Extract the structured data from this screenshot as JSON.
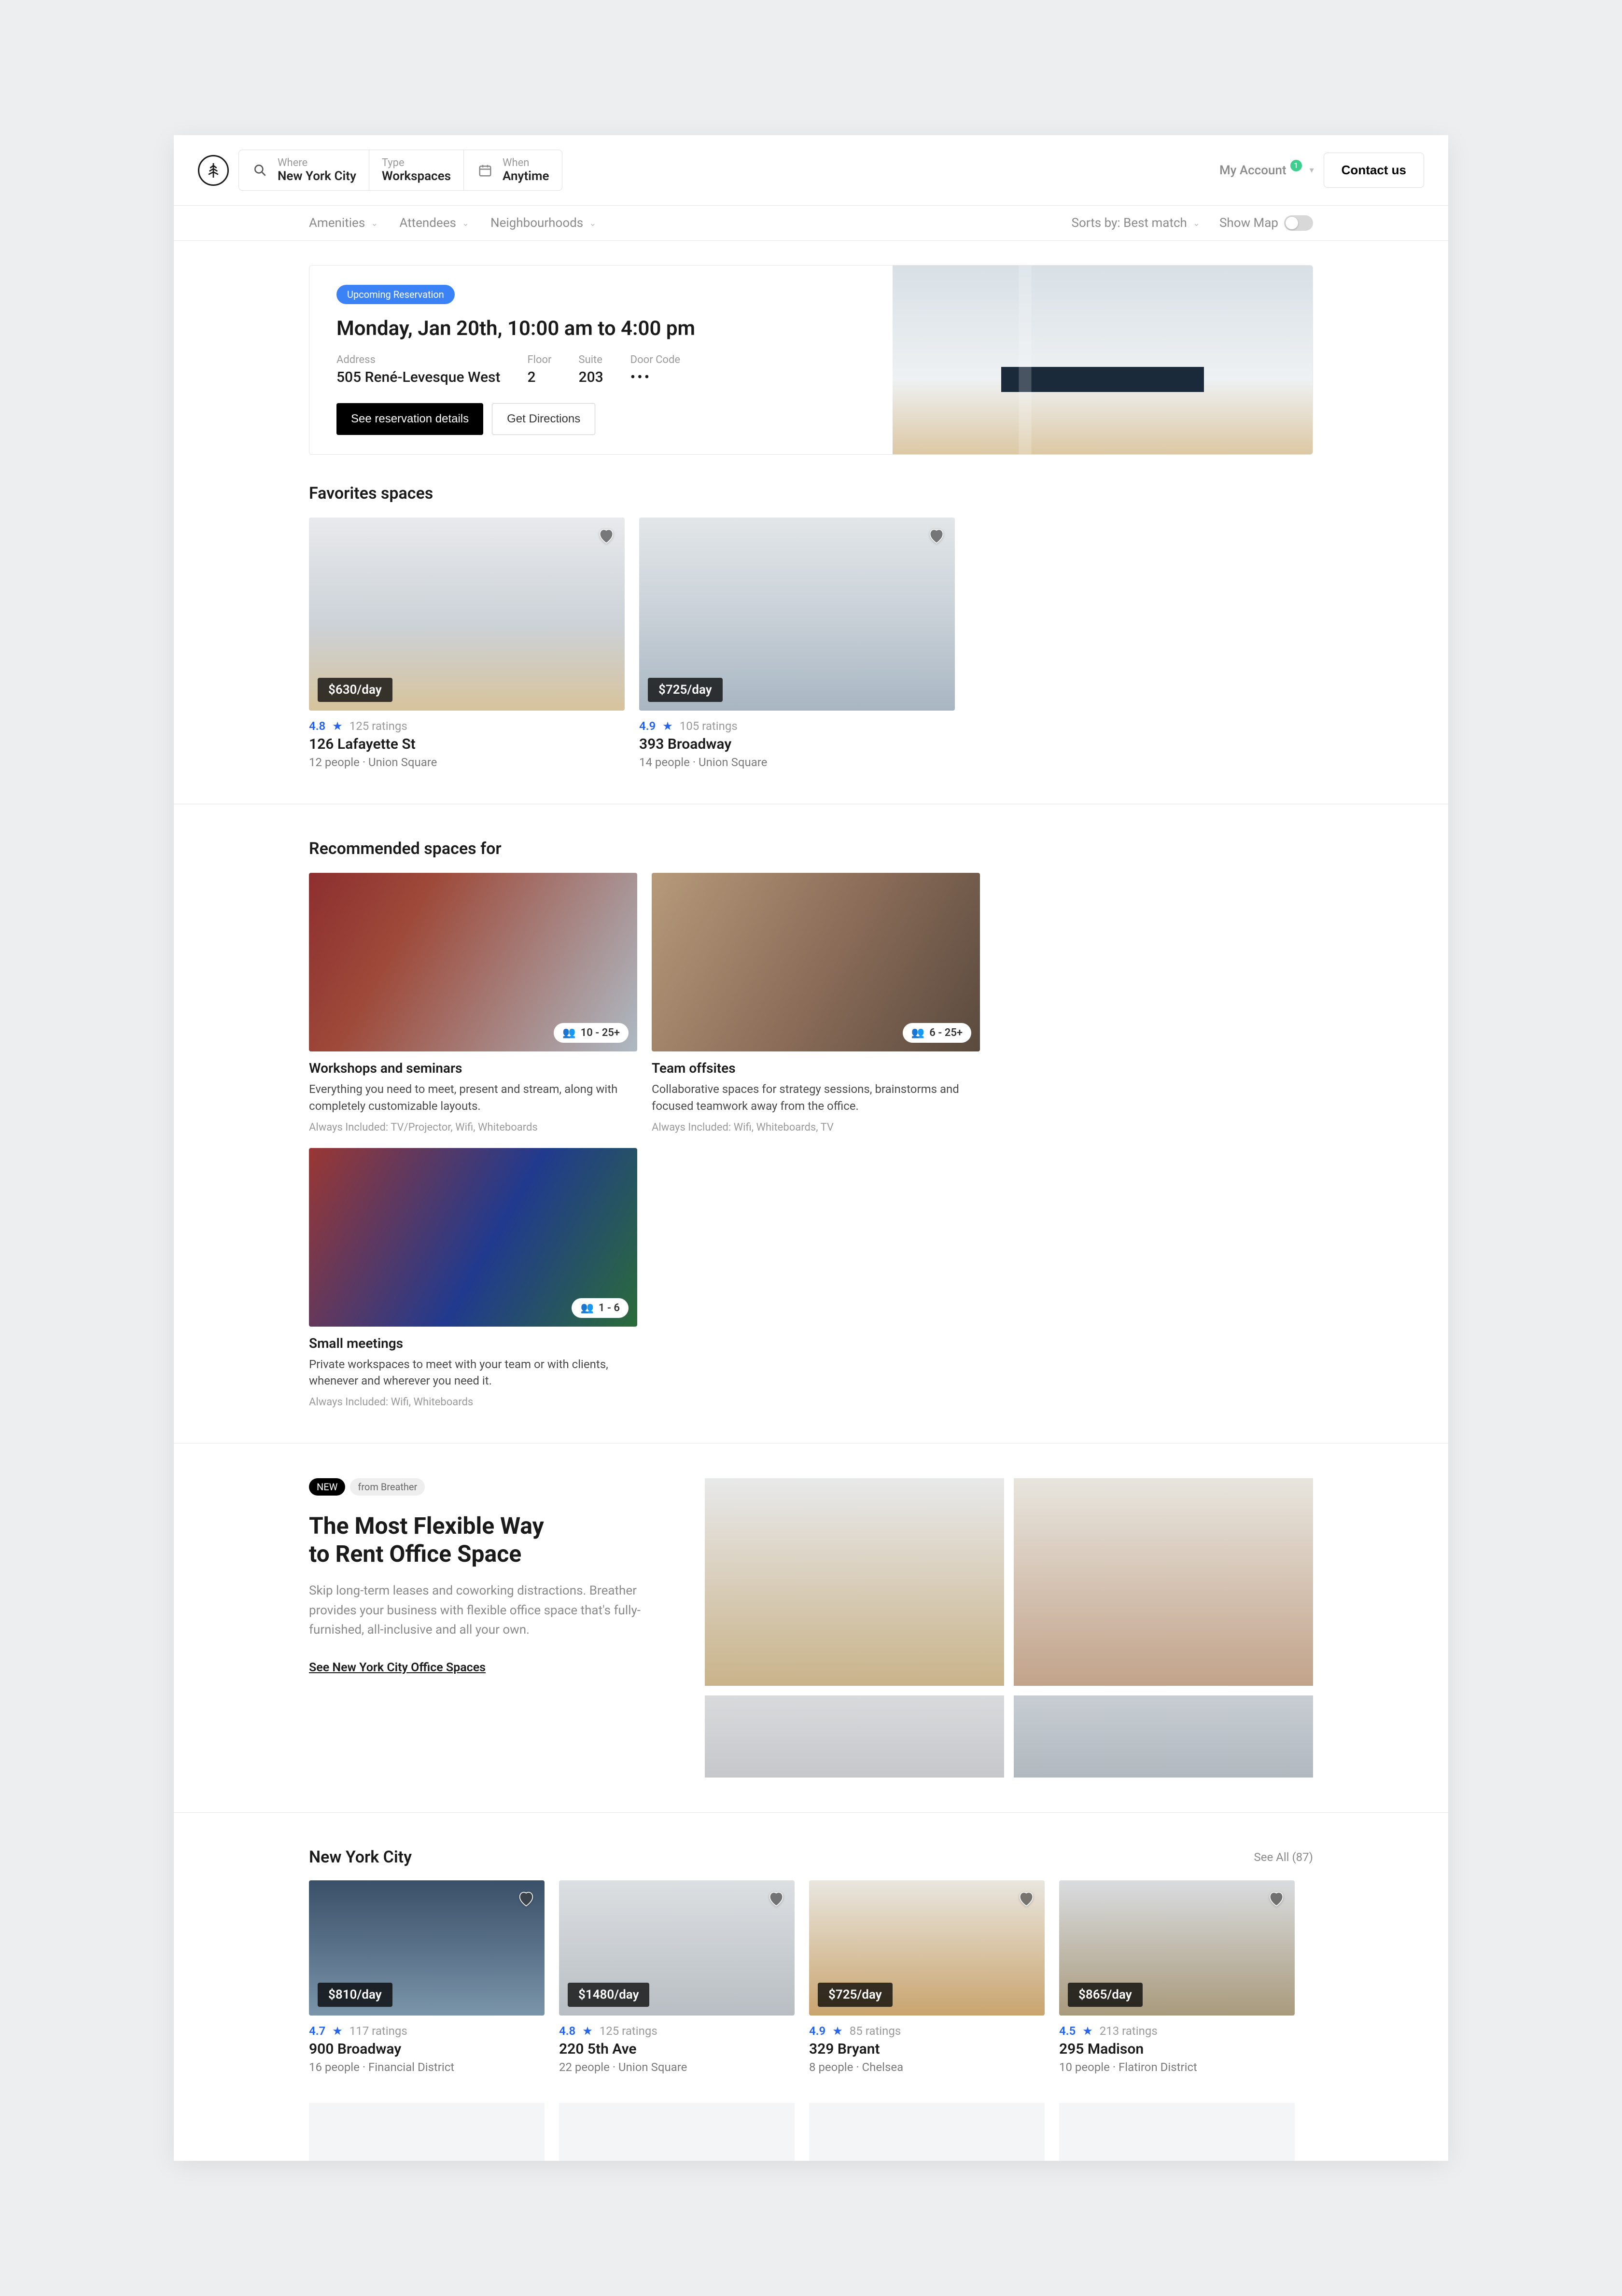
{
  "header": {
    "search": {
      "where_label": "Where",
      "where_value": "New York City",
      "type_label": "Type",
      "type_value": "Workspaces",
      "when_label": "When",
      "when_value": "Anytime"
    },
    "account_label": "My Account",
    "account_badge": "1",
    "contact_label": "Contact  us"
  },
  "filters": {
    "amenities": "Amenities",
    "attendees": "Attendees",
    "neighbourhoods": "Neighbourhoods",
    "sort_label": "Sorts by: Best match",
    "show_map": "Show Map"
  },
  "reservation": {
    "pill": "Upcoming Reservation",
    "title": "Monday, Jan 20th, 10:00 am to 4:00 pm",
    "address_label": "Address",
    "address_value": "505 René-Levesque West",
    "floor_label": "Floor",
    "floor_value": "2",
    "suite_label": "Suite",
    "suite_value": "203",
    "door_label": "Door Code",
    "door_value": "•••",
    "btn_details": "See reservation details",
    "btn_directions": "Get Directions"
  },
  "favorites": {
    "title": "Favorites spaces",
    "items": [
      {
        "price": "$630/day",
        "rating": "4.8",
        "ratings_count": "125 ratings",
        "name": "126 Lafayette St",
        "sub": "12 people · Union Square"
      },
      {
        "price": "$725/day",
        "rating": "4.9",
        "ratings_count": "105 ratings",
        "name": "393 Broadway",
        "sub": "14 people · Union Square"
      }
    ]
  },
  "recommended": {
    "title": "Recommended spaces for",
    "items": [
      {
        "cap": "10 - 25+",
        "name": "Workshops and seminars",
        "desc": "Everything you need to meet, present and stream, along with completely customizable layouts.",
        "inc": "Always Included: TV/Projector, Wifi, Whiteboards"
      },
      {
        "cap": "6 - 25+",
        "name": "Team offsites",
        "desc": "Collaborative spaces for strategy sessions, brainstorms and focused teamwork away from the office.",
        "inc": "Always Included: Wifi, Whiteboards, TV"
      },
      {
        "cap": "1 - 6",
        "name": "Small meetings",
        "desc": "Private workspaces to meet with your team or with clients, whenever and wherever you need it.",
        "inc": "Always Included: Wifi, Whiteboards"
      }
    ]
  },
  "promo": {
    "chip_new": "NEW",
    "chip_from": "from Breather",
    "heading1": "The Most Flexible Way",
    "heading2": "to Rent Office Space",
    "body": "Skip long-term leases and coworking distractions. Breather provides your business with flexible office space that's fully-furnished, all-inclusive and all your own.",
    "link": "See New York City Office Spaces"
  },
  "nyc": {
    "title": "New York City",
    "see_all": "See All (87)",
    "items": [
      {
        "price": "$810/day",
        "rating": "4.7",
        "ratings_count": "117 ratings",
        "name": "900 Broadway",
        "sub": "16 people · Financial District"
      },
      {
        "price": "$1480/day",
        "rating": "4.8",
        "ratings_count": "125 ratings",
        "name": "220 5th Ave",
        "sub": "22 people · Union Square"
      },
      {
        "price": "$725/day",
        "rating": "4.9",
        "ratings_count": "85 ratings",
        "name": "329 Bryant",
        "sub": "8 people · Chelsea"
      },
      {
        "price": "$865/day",
        "rating": "4.5",
        "ratings_count": "213 ratings",
        "name": "295 Madison",
        "sub": "10 people · Flatiron District"
      }
    ]
  }
}
